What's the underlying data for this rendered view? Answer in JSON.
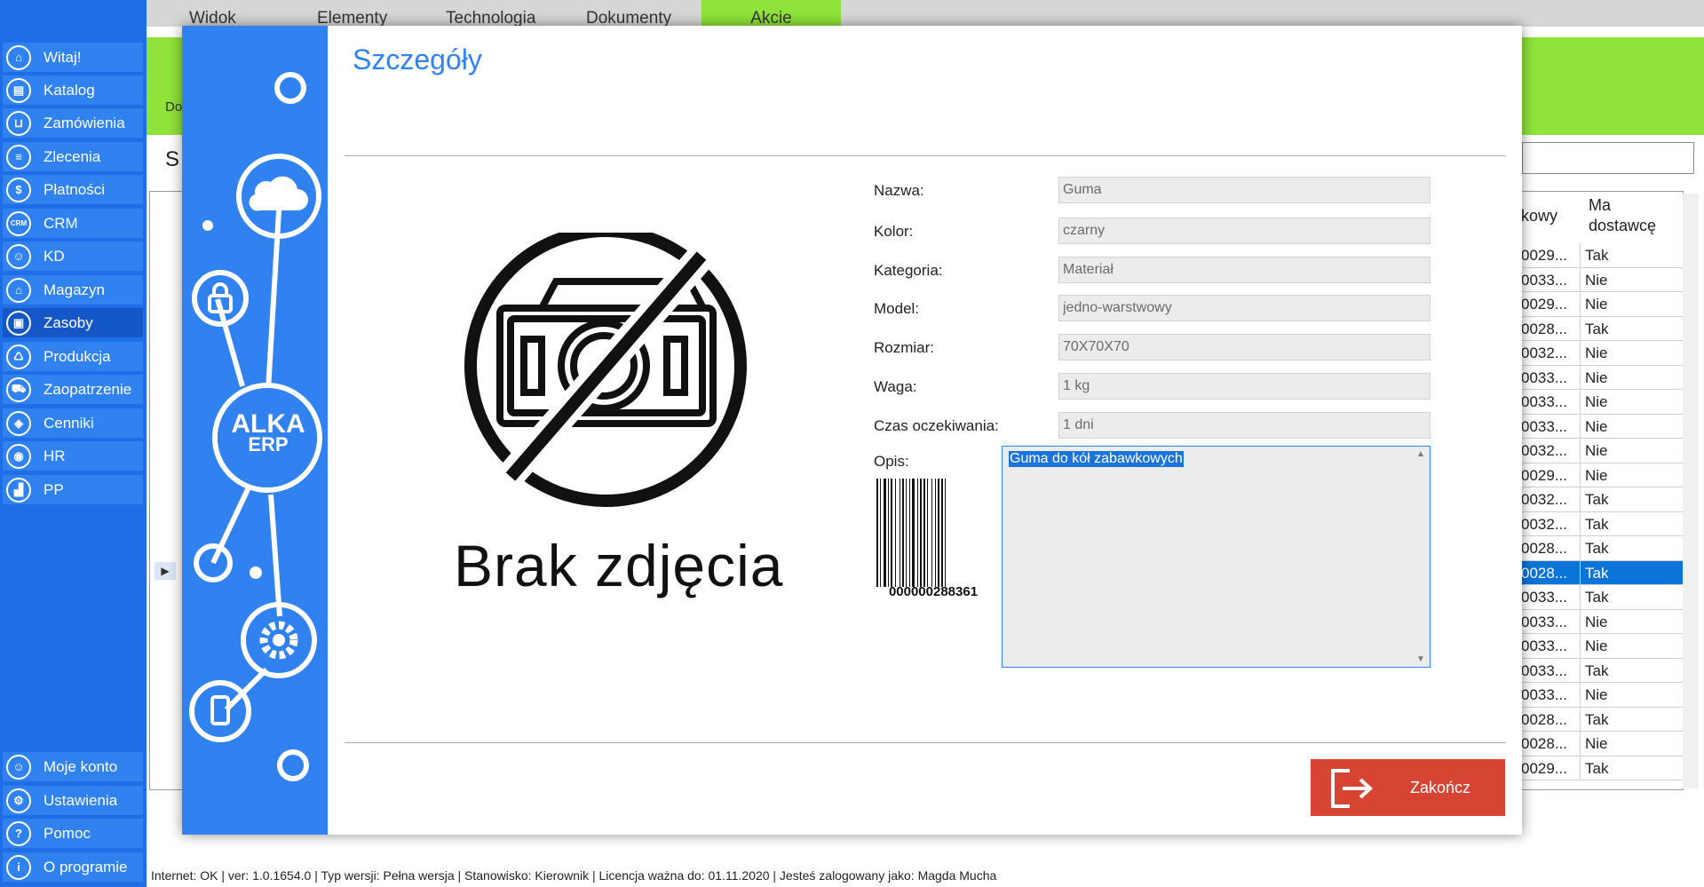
{
  "top_tabs": [
    "Widok",
    "Elementy",
    "Technologia",
    "Dokumenty",
    "Akcie"
  ],
  "sidebar": {
    "items": [
      {
        "label": "Witaj!",
        "icon": "home-icon"
      },
      {
        "label": "Katalog",
        "icon": "book-icon"
      },
      {
        "label": "Zamówienia",
        "icon": "cart-icon"
      },
      {
        "label": "Zlecenia",
        "icon": "list-icon"
      },
      {
        "label": "Płatności",
        "icon": "dollar-icon"
      },
      {
        "label": "CRM",
        "icon": "crm-icon"
      },
      {
        "label": "KD",
        "icon": "person-icon"
      },
      {
        "label": "Magazyn",
        "icon": "warehouse-icon"
      },
      {
        "label": "Zasoby",
        "icon": "box-icon"
      },
      {
        "label": "Produkcja",
        "icon": "production-icon"
      },
      {
        "label": "Zaopatrzenie",
        "icon": "truck-icon"
      },
      {
        "label": "Cenniki",
        "icon": "tag-icon"
      },
      {
        "label": "HR",
        "icon": "hr-icon"
      },
      {
        "label": "PP",
        "icon": "factory-icon"
      }
    ],
    "bottom_items": [
      {
        "label": "Moje konto",
        "icon": "account-icon"
      },
      {
        "label": "Ustawienia",
        "icon": "gear-icon"
      },
      {
        "label": "Pomoc",
        "icon": "help-icon"
      },
      {
        "label": "O programie",
        "icon": "info-icon"
      }
    ]
  },
  "background": {
    "breadcrumb_fragment": "Do",
    "title_fragment": "S"
  },
  "grid": {
    "headers": [
      "kowy",
      "Ma dostawcę"
    ],
    "rows": [
      {
        "code": "0029...",
        "flag": "Tak"
      },
      {
        "code": "0033...",
        "flag": "Nie"
      },
      {
        "code": "0029...",
        "flag": "Nie"
      },
      {
        "code": "0028...",
        "flag": "Tak"
      },
      {
        "code": "0032...",
        "flag": "Nie"
      },
      {
        "code": "0033...",
        "flag": "Nie"
      },
      {
        "code": "0033...",
        "flag": "Nie"
      },
      {
        "code": "0033...",
        "flag": "Nie"
      },
      {
        "code": "0032...",
        "flag": "Nie"
      },
      {
        "code": "0029...",
        "flag": "Nie"
      },
      {
        "code": "0032...",
        "flag": "Tak"
      },
      {
        "code": "0032...",
        "flag": "Tak"
      },
      {
        "code": "0028...",
        "flag": "Tak"
      },
      {
        "code": "0028...",
        "flag": "Tak"
      },
      {
        "code": "0033...",
        "flag": "Tak"
      },
      {
        "code": "0033...",
        "flag": "Nie"
      },
      {
        "code": "0033...",
        "flag": "Nie"
      },
      {
        "code": "0033...",
        "flag": "Tak"
      },
      {
        "code": "0033...",
        "flag": "Nie"
      },
      {
        "code": "0028...",
        "flag": "Tak"
      },
      {
        "code": "0028...",
        "flag": "Nie"
      },
      {
        "code": "0029...",
        "flag": "Tak"
      }
    ],
    "selected_index": 13
  },
  "modal": {
    "title": "Szczegóły",
    "brand_line1": "ALKA",
    "brand_line2": "ERP",
    "no_image_text": "Brak zdjęcia",
    "fields": [
      {
        "label": "Nazwa:",
        "value": "Guma"
      },
      {
        "label": "Kolor:",
        "value": "czarny"
      },
      {
        "label": "Kategoria:",
        "value": "Materiał"
      },
      {
        "label": "Model:",
        "value": "jedno-warstwowy"
      },
      {
        "label": "Rozmiar:",
        "value": "70X70X70"
      },
      {
        "label": "Waga:",
        "value": "1 kg"
      },
      {
        "label": "Czas oczekiwania:",
        "value": "1 dni"
      }
    ],
    "description_label": "Opis:",
    "description": "Guma do kół zabawkowych",
    "barcode_number": "000000288361",
    "exit_label": "Zakończ"
  },
  "status_bar": "Internet: OK  |   ver: 1.0.1654.0   |   Typ wersji: Pełna wersja   |   Stanowisko: Kierownik   |   Licencja ważna do: 01.11.2020   |   Jesteś zalogowany jako: Magda Mucha",
  "colors": {
    "sidebar_blue": "#1e6ee8",
    "accent_green": "#8fe33a",
    "exit_red": "#d84434",
    "selection_blue": "#0a74d8"
  }
}
